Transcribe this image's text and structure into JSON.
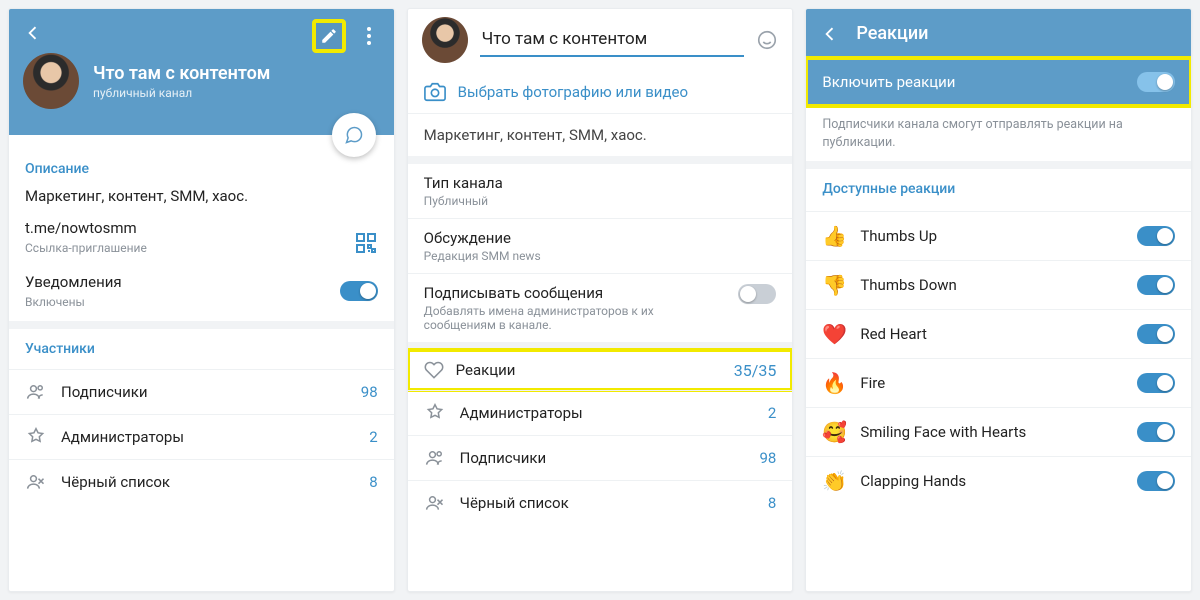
{
  "pane1": {
    "channel_name": "Что там с контентом",
    "channel_subtitle": "публичный канал",
    "desc_header": "Описание",
    "description": "Маркетинг, контент, SMM, хаос.",
    "link": "t.me/nowtosmm",
    "link_label": "Ссылка-приглашение",
    "notif_label": "Уведомления",
    "notif_state": "Включены",
    "members_header": "Участники",
    "rows": [
      {
        "label": "Подписчики",
        "value": "98"
      },
      {
        "label": "Администраторы",
        "value": "2"
      },
      {
        "label": "Чёрный список",
        "value": "8"
      }
    ]
  },
  "pane2": {
    "name_value": "Что там с контентом",
    "pick_photo": "Выбрать фотографию или видео",
    "description": "Маркетинг, контент, SMM, хаос.",
    "type_label": "Тип канала",
    "type_value": "Публичный",
    "discussion_label": "Обсуждение",
    "discussion_value": "Редакция SMM news",
    "sign_label": "Подписывать сообщения",
    "sign_hint": "Добавлять имена администраторов к их сообщениям в канале.",
    "reactions_label": "Реакции",
    "reactions_value": "35/35",
    "rows": [
      {
        "label": "Администраторы",
        "value": "2"
      },
      {
        "label": "Подписчики",
        "value": "98"
      },
      {
        "label": "Чёрный список",
        "value": "8"
      }
    ]
  },
  "pane3": {
    "title": "Реакции",
    "enable_label": "Включить реакции",
    "hint": "Подписчики канала смогут отправлять реакции на публикации.",
    "available_header": "Доступные реакции",
    "items": [
      {
        "emoji": "👍",
        "label": "Thumbs Up"
      },
      {
        "emoji": "👎",
        "label": "Thumbs Down"
      },
      {
        "emoji": "❤️",
        "label": "Red Heart"
      },
      {
        "emoji": "🔥",
        "label": "Fire"
      },
      {
        "emoji": "🥰",
        "label": "Smiling Face with Hearts"
      },
      {
        "emoji": "👏",
        "label": "Clapping Hands"
      }
    ]
  }
}
